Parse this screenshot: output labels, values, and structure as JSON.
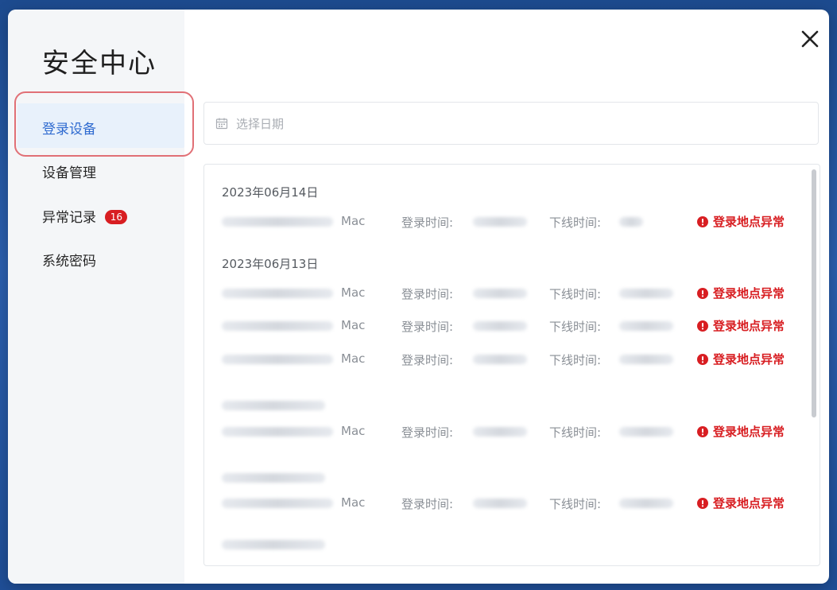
{
  "modal": {
    "title": "安全中心",
    "close_icon": "close-icon"
  },
  "sidebar": {
    "items": [
      {
        "label": "登录设备",
        "active": true
      },
      {
        "label": "设备管理",
        "active": false
      },
      {
        "label": "异常记录",
        "active": false,
        "badge": "16"
      },
      {
        "label": "系统密码",
        "active": false
      }
    ]
  },
  "date_picker": {
    "placeholder": "选择日期",
    "icon": "calendar-icon"
  },
  "records": {
    "groups": [
      {
        "date": "2023年06月14日",
        "rows": [
          {
            "device": "Mac",
            "login_label": "登录时间:",
            "logout_label": "下线时间:",
            "alert": "登录地点异常"
          }
        ]
      },
      {
        "date": "2023年06月13日",
        "rows": [
          {
            "device": "Mac",
            "login_label": "登录时间:",
            "logout_label": "下线时间:",
            "alert": "登录地点异常"
          },
          {
            "device": "Mac",
            "login_label": "登录时间:",
            "logout_label": "下线时间:",
            "alert": "登录地点异常"
          },
          {
            "device": "Mac",
            "login_label": "登录时间:",
            "logout_label": "下线时间:",
            "alert": "登录地点异常"
          }
        ]
      },
      {
        "date": "",
        "rows": [
          {
            "device": "Mac",
            "login_label": "登录时间:",
            "logout_label": "下线时间:",
            "alert": "登录地点异常"
          }
        ]
      },
      {
        "date": "",
        "rows": [
          {
            "device": "Mac",
            "login_label": "登录时间:",
            "logout_label": "下线时间:",
            "alert": "登录地点异常"
          }
        ]
      }
    ]
  },
  "colors": {
    "accent": "#2f6bd0",
    "alert": "#d81e22",
    "highlight_ring": "#e17076"
  }
}
